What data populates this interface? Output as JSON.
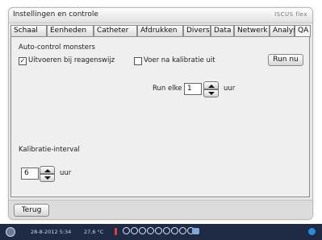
{
  "window": {
    "title": "Instellingen en controle",
    "brand": "ISCUS flex"
  },
  "tabs": [
    {
      "label": "Schaal"
    },
    {
      "label": "Eenheden"
    },
    {
      "label": "Catheter"
    },
    {
      "label": "Afdrukken"
    },
    {
      "label": "Divers"
    },
    {
      "label": "Data"
    },
    {
      "label": "Netwerk"
    },
    {
      "label": "Analyses"
    },
    {
      "label": "QA"
    }
  ],
  "active_tab": "QA",
  "autocontrol": {
    "section_label": "Auto-control monsters",
    "option1_label": "Uitvoeren bij reagenswijz",
    "option1_checked": true,
    "option2_label": "Voer na kalibratie uit",
    "option2_checked": false,
    "run_now_label": "Run nu",
    "run_every_label": "Run elke",
    "run_every_value": "1",
    "run_every_unit": "uur"
  },
  "calibration": {
    "section_label": "Kalibratie-interval",
    "value": "6",
    "unit": "uur"
  },
  "footer": {
    "back_label": "Terug"
  },
  "statusbar": {
    "datetime": "28-8-2012 5:34",
    "temperature": "27,6 °C"
  },
  "colors": {
    "statusbar_bg": "#1f2a44",
    "panel_bg": "#efefef",
    "accent": "#2a8cd8"
  }
}
